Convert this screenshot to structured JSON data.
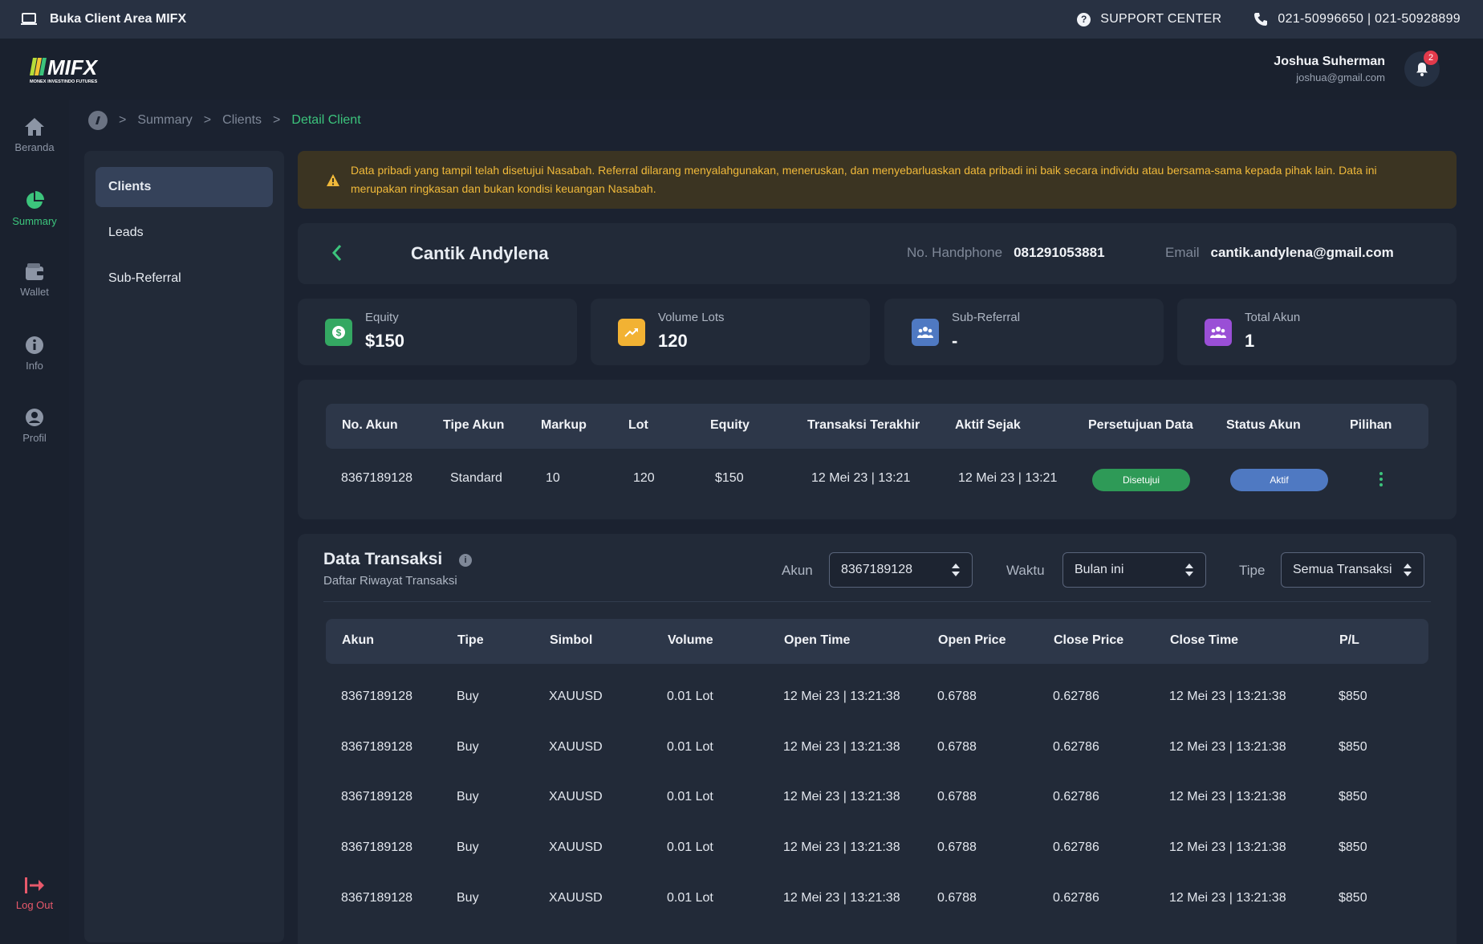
{
  "topbar": {
    "client_area_label": "Buka Client Area MIFX",
    "support_label": "SUPPORT CENTER",
    "phone_label": "021-50996650 | 021-50928899"
  },
  "brand": {
    "logo_text": "MIFX",
    "logo_sub": "MONEX INVESTINDO FUTURES"
  },
  "user": {
    "name": "Joshua Suherman",
    "email": "joshua@gmail.com",
    "notifications": "2"
  },
  "rail": [
    {
      "label": "Beranda",
      "icon": "home-icon"
    },
    {
      "label": "Summary",
      "icon": "pie-chart-icon"
    },
    {
      "label": "Wallet",
      "icon": "wallet-icon"
    },
    {
      "label": "Info",
      "icon": "info-icon"
    },
    {
      "label": "Profil",
      "icon": "user-icon"
    }
  ],
  "logout_label": "Log Out",
  "breadcrumb": {
    "items": [
      "Summary",
      "Clients"
    ],
    "current": "Detail Client"
  },
  "submenu": [
    "Clients",
    "Leads",
    "Sub-Referral"
  ],
  "warning": "Data pribadi yang tampil telah disetujui Nasabah. Referral dilarang menyalahgunakan, meneruskan, dan menyebarluaskan data pribadi ini baik secara individu atau bersama-sama kepada pihak lain. Data ini merupakan ringkasan dan bukan kondisi keuangan Nasabah.",
  "client": {
    "name": "Cantik Andylena",
    "phone_label": "No. Handphone",
    "phone": "081291053881",
    "email_label": "Email",
    "email": "cantik.andylena@gmail.com"
  },
  "stats": [
    {
      "label": "Equity",
      "value": "$150",
      "icon": "dollar-icon",
      "color": "#34a862"
    },
    {
      "label": "Volume Lots",
      "value": "120",
      "icon": "trend-up-icon",
      "color": "#f2b233"
    },
    {
      "label": "Sub-Referral",
      "value": "-",
      "icon": "group-icon",
      "color": "#4f79c2"
    },
    {
      "label": "Total Akun",
      "value": "1",
      "icon": "group-icon",
      "color": "#9a4fd6"
    }
  ],
  "accounts": {
    "headers": [
      "No. Akun",
      "Tipe Akun",
      "Markup",
      "Lot",
      "Equity",
      "Transaksi Terakhir",
      "Aktif Sejak",
      "Persetujuan Data",
      "Status Akun",
      "Pilihan"
    ],
    "rows": [
      {
        "no": "8367189128",
        "tipe": "Standard",
        "markup": "10",
        "lot": "120",
        "equity": "$150",
        "last_tx": "12 Mei 23 | 13:21",
        "since": "12 Mei 23 | 13:21",
        "consent": "Disetujui",
        "status": "Aktif"
      }
    ]
  },
  "transactions": {
    "title": "Data Transaksi",
    "subtitle": "Daftar Riwayat Transaksi",
    "filters": {
      "akun_label": "Akun",
      "akun_value": "8367189128",
      "waktu_label": "Waktu",
      "waktu_value": "Bulan ini",
      "tipe_label": "Tipe",
      "tipe_value": "Semua Transaksi"
    },
    "headers": [
      "Akun",
      "Tipe",
      "Simbol",
      "Volume",
      "Open Time",
      "Open Price",
      "Close Price",
      "Close Time",
      "P/L"
    ],
    "rows": [
      [
        "8367189128",
        "Buy",
        "XAUUSD",
        "0.01 Lot",
        "12 Mei 23 | 13:21:38",
        "0.6788",
        "0.62786",
        "12 Mei 23 | 13:21:38",
        "$850"
      ],
      [
        "8367189128",
        "Buy",
        "XAUUSD",
        "0.01 Lot",
        "12 Mei 23 | 13:21:38",
        "0.6788",
        "0.62786",
        "12 Mei 23 | 13:21:38",
        "$850"
      ],
      [
        "8367189128",
        "Buy",
        "XAUUSD",
        "0.01 Lot",
        "12 Mei 23 | 13:21:38",
        "0.6788",
        "0.62786",
        "12 Mei 23 | 13:21:38",
        "$850"
      ],
      [
        "8367189128",
        "Buy",
        "XAUUSD",
        "0.01 Lot",
        "12 Mei 23 | 13:21:38",
        "0.6788",
        "0.62786",
        "12 Mei 23 | 13:21:38",
        "$850"
      ],
      [
        "8367189128",
        "Buy",
        "XAUUSD",
        "0.01 Lot",
        "12 Mei 23 | 13:21:38",
        "0.6788",
        "0.62786",
        "12 Mei 23 | 13:21:38",
        "$850"
      ]
    ]
  }
}
